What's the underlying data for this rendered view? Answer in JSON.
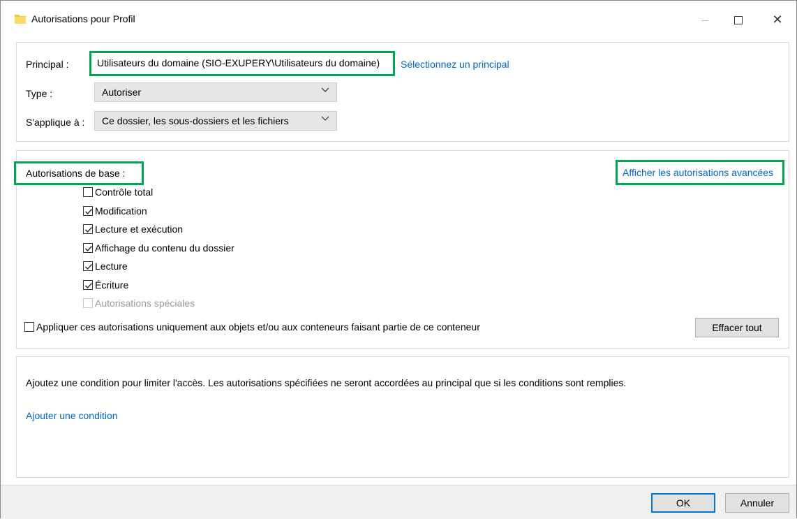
{
  "window": {
    "title": "Autorisations pour Profil",
    "icon": "folder-icon",
    "controls": [
      "minimize-icon",
      "maximize-icon",
      "close-icon"
    ],
    "close_glyph": "✕"
  },
  "principal_section": {
    "principal_label": "Principal :",
    "principal_value": "Utilisateurs du domaine (SIO-EXUPERY\\Utilisateurs du domaine)",
    "select_principal_link": "Sélectionnez un principal",
    "type_label": "Type :",
    "type_value": "Autoriser",
    "applies_label": "S'applique à :",
    "applies_value": "Ce dossier, les sous-dossiers et les fichiers"
  },
  "permissions_section": {
    "heading": "Autorisations de base :",
    "advanced_link": "Afficher les autorisations avancées",
    "items": [
      {
        "label": "Contrôle total",
        "checked": false,
        "disabled": false
      },
      {
        "label": "Modification",
        "checked": true,
        "disabled": false
      },
      {
        "label": "Lecture et exécution",
        "checked": true,
        "disabled": false
      },
      {
        "label": "Affichage du contenu du dossier",
        "checked": true,
        "disabled": false
      },
      {
        "label": "Lecture",
        "checked": true,
        "disabled": false
      },
      {
        "label": "Écriture",
        "checked": true,
        "disabled": false
      },
      {
        "label": "Autorisations spéciales",
        "checked": false,
        "disabled": true
      }
    ],
    "apply_only_label": "Appliquer ces autorisations uniquement aux objets et/ou aux conteneurs faisant partie de ce conteneur",
    "apply_only_checked": false,
    "clear_all_button": "Effacer tout"
  },
  "condition_section": {
    "description": "Ajoutez une condition pour limiter l'accès. Les autorisations spécifiées ne seront accordées au principal que si les conditions sont remplies.",
    "add_condition_link": "Ajouter une condition"
  },
  "footer": {
    "ok_button": "OK",
    "cancel_button": "Annuler"
  },
  "colors": {
    "highlight": "#00a650",
    "link": "#0066cc",
    "focus_border": "#0078d7"
  }
}
